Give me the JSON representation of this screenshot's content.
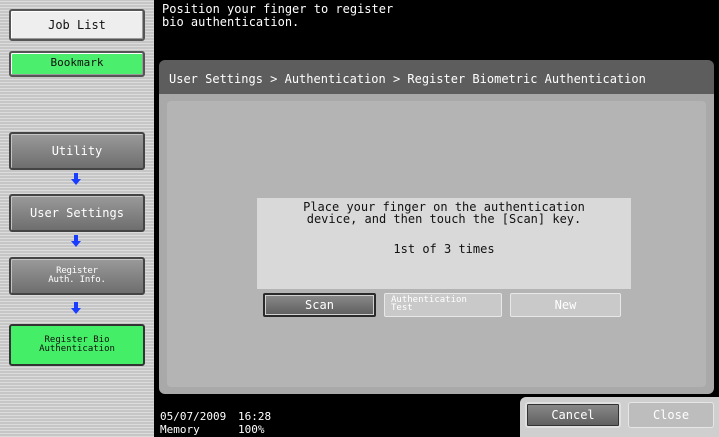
{
  "sidebar": {
    "job_list": "Job List",
    "bookmark": "Bookmark",
    "utility": "Utility",
    "user_settings": "User Settings",
    "register_auth_line1": "Register",
    "register_auth_line2": "Auth. Info.",
    "register_bio_line1": "Register Bio",
    "register_bio_line2": "Authentication",
    "arrow_icon": "down-arrow-icon",
    "arrow_color": "#1a3cff",
    "active_color": "#44ee66"
  },
  "header": {
    "message": "Position your finger to register\nbio authentication."
  },
  "breadcrumb": "User Settings > Authentication > Register Biometric Authentication",
  "instruction": {
    "line1": "Place your finger on the authentication",
    "line2": "device, and then touch the [Scan] key.",
    "progress": "1st of 3 times"
  },
  "buttons": {
    "scan": "Scan",
    "auth_test_line1": "Authentication",
    "auth_test_line2": "Test",
    "new": "New",
    "cancel": "Cancel",
    "close": "Close"
  },
  "status": {
    "date": "05/07/2009",
    "time": "16:28",
    "memory_label": "Memory",
    "memory_value": "100%"
  }
}
